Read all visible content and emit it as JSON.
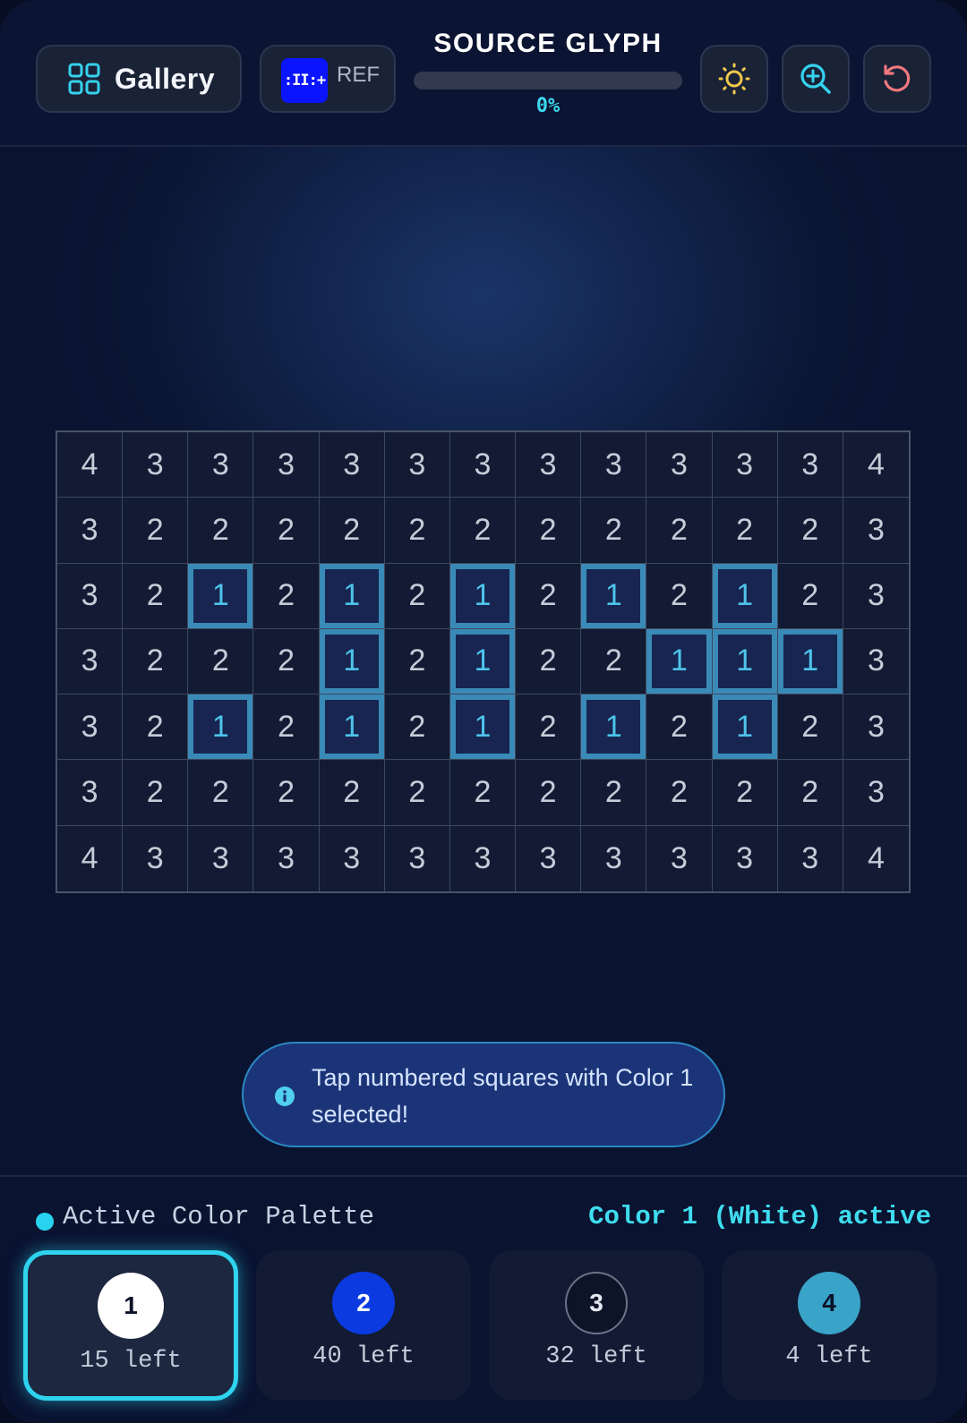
{
  "header": {
    "gallery_label": "Gallery",
    "ref_label": "REF",
    "ref_thumb_text": ":II:+",
    "title": "SOURCE GLYPH",
    "progress_text": "0%",
    "progress_fraction": 0
  },
  "grid": {
    "rows": 7,
    "cols": 13,
    "numbers": [
      [
        4,
        3,
        3,
        3,
        3,
        3,
        3,
        3,
        3,
        3,
        3,
        3,
        4
      ],
      [
        3,
        2,
        2,
        2,
        2,
        2,
        2,
        2,
        2,
        2,
        2,
        2,
        3
      ],
      [
        3,
        2,
        1,
        2,
        1,
        2,
        1,
        2,
        1,
        2,
        1,
        2,
        3
      ],
      [
        3,
        2,
        2,
        2,
        1,
        2,
        1,
        2,
        2,
        1,
        1,
        1,
        3
      ],
      [
        3,
        2,
        1,
        2,
        1,
        2,
        1,
        2,
        1,
        2,
        1,
        2,
        3
      ],
      [
        3,
        2,
        2,
        2,
        2,
        2,
        2,
        2,
        2,
        2,
        2,
        2,
        3
      ],
      [
        4,
        3,
        3,
        3,
        3,
        3,
        3,
        3,
        3,
        3,
        3,
        3,
        4
      ]
    ],
    "highlighted_number": 1
  },
  "hint": {
    "text": "Tap numbered squares with Color 1 selected!"
  },
  "palette": {
    "title": "Active Color Palette",
    "status": "Color 1 (White) active",
    "active_index": 0,
    "colors": [
      {
        "number": "1",
        "count_text": "15 left",
        "fill": "#ffffff",
        "text_color": "#0b1228"
      },
      {
        "number": "2",
        "count_text": "40 left",
        "fill": "#0b3be0",
        "text_color": "#ffffff"
      },
      {
        "number": "3",
        "count_text": "32 left",
        "fill": "#0e1428",
        "text_color": "#e2e7f0"
      },
      {
        "number": "4",
        "count_text": "4 left",
        "fill": "#3aa3c8",
        "text_color": "#0b1228"
      }
    ]
  },
  "colors": {
    "accent": "#2ed4ee",
    "background": "#0a1330"
  }
}
